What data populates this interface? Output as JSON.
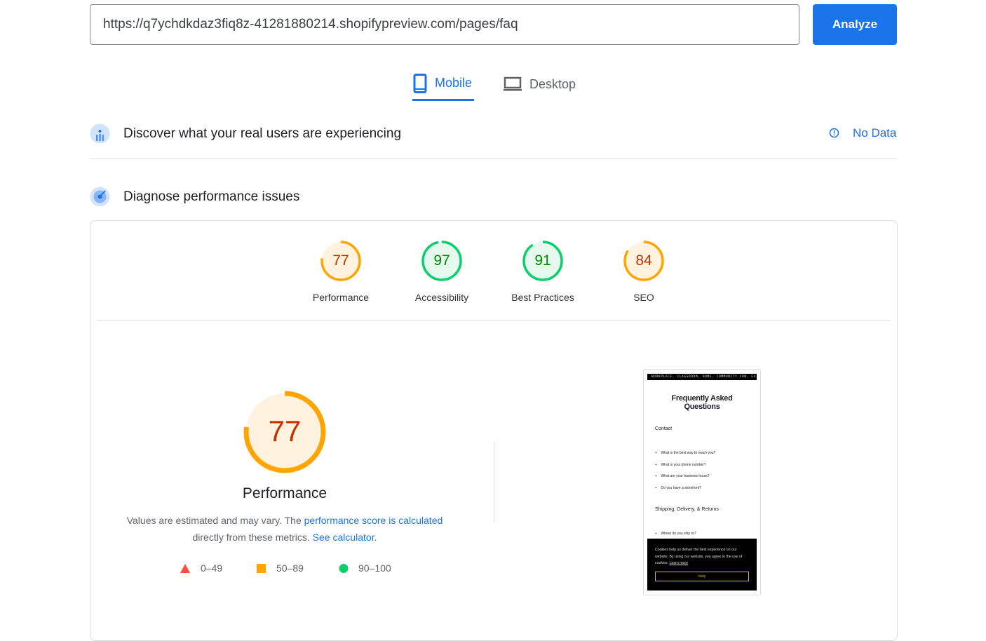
{
  "search": {
    "url": "https://q7ychdkdaz3fiq8z-41281880214.shopifypreview.com/pages/faq",
    "analyze_label": "Analyze"
  },
  "tabs": [
    {
      "label": "Mobile",
      "icon": "smartphone-icon",
      "active": true
    },
    {
      "label": "Desktop",
      "icon": "laptop-icon",
      "active": false
    }
  ],
  "field_data": {
    "title": "Discover what your real users are experiencing",
    "status": "No Data",
    "status_icon": "info-icon"
  },
  "lab": {
    "title": "Diagnose performance issues"
  },
  "colors": {
    "accent": "#1a73e8",
    "average": "#ffa400",
    "average_text": "#c33300",
    "average_bg": "#fff3e0",
    "pass": "#0cce6b",
    "pass_text": "#008800",
    "pass_bg": "#e6f9ef",
    "fail": "#ff4e42"
  },
  "scores": [
    {
      "label": "Performance",
      "score": 77,
      "rating": "average"
    },
    {
      "label": "Accessibility",
      "score": 97,
      "rating": "pass"
    },
    {
      "label": "Best Practices",
      "score": 91,
      "rating": "pass"
    },
    {
      "label": "SEO",
      "score": 84,
      "rating": "average"
    }
  ],
  "performance": {
    "score": 77,
    "title": "Performance",
    "desc_prefix": "Values are estimated and may vary. The ",
    "desc_link1": "performance score is calculated",
    "desc_middle": " directly from these metrics. ",
    "desc_link2": "See calculator."
  },
  "legend": [
    {
      "range": "0–49",
      "shape": "triangle",
      "color": "#ff4e42"
    },
    {
      "range": "50–89",
      "shape": "square",
      "color": "#ffa400"
    },
    {
      "range": "90–100",
      "shape": "circle",
      "color": "#0cce6b"
    }
  ],
  "screenshot": {
    "banner": "WORKPLACE, CLASSROOM, HOME, COMMUNITY   FUN, EA",
    "title_line1": "Frequently Asked",
    "title_line2": "Questions",
    "section1": "Contact",
    "questions": [
      "What is the best way to reach you?",
      "What is your phone number?",
      "What are your business hours?",
      "Do you have a storefront?"
    ],
    "section2": "Shipping, Delivery, & Returns",
    "partial_question": "Where do you ship to?",
    "cookie_text": "Cookies help us deliver the best experience on our website. By using our website, you agree to the use of cookies.",
    "cookie_link": "Learn more",
    "cookie_button": "okay"
  }
}
